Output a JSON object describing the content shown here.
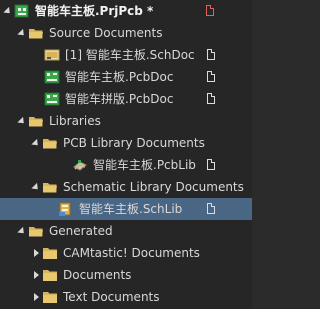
{
  "project": {
    "label": "智能车主板.PrjPcb *",
    "icon": "pcb-project-icon"
  },
  "source_documents": {
    "label": "Source Documents",
    "items": [
      {
        "label": "[1] 智能车主板.SchDoc",
        "icon": "schematic-doc-icon"
      },
      {
        "label": "智能车主板.PcbDoc",
        "icon": "pcb-doc-icon"
      },
      {
        "label": "智能车拼版.PcbDoc",
        "icon": "pcb-doc-icon"
      }
    ]
  },
  "libraries": {
    "label": "Libraries",
    "pcb_library": {
      "label": "PCB Library Documents",
      "items": [
        {
          "label": "智能车主板.PcbLib",
          "icon": "pcb-library-icon"
        }
      ]
    },
    "schematic_library": {
      "label": "Schematic Library Documents",
      "items": [
        {
          "label": "智能车主板.SchLib",
          "icon": "schematic-library-icon"
        }
      ]
    }
  },
  "generated": {
    "label": "Generated",
    "items": [
      {
        "label": "CAMtastic! Documents"
      },
      {
        "label": "Documents"
      },
      {
        "label": "Text Documents"
      }
    ]
  },
  "colors": {
    "background": "#262626",
    "selection": "#4a6685",
    "folder": "#d9b35a",
    "pcb_green": "#3aa84a",
    "modified_badge": "#e06060"
  }
}
